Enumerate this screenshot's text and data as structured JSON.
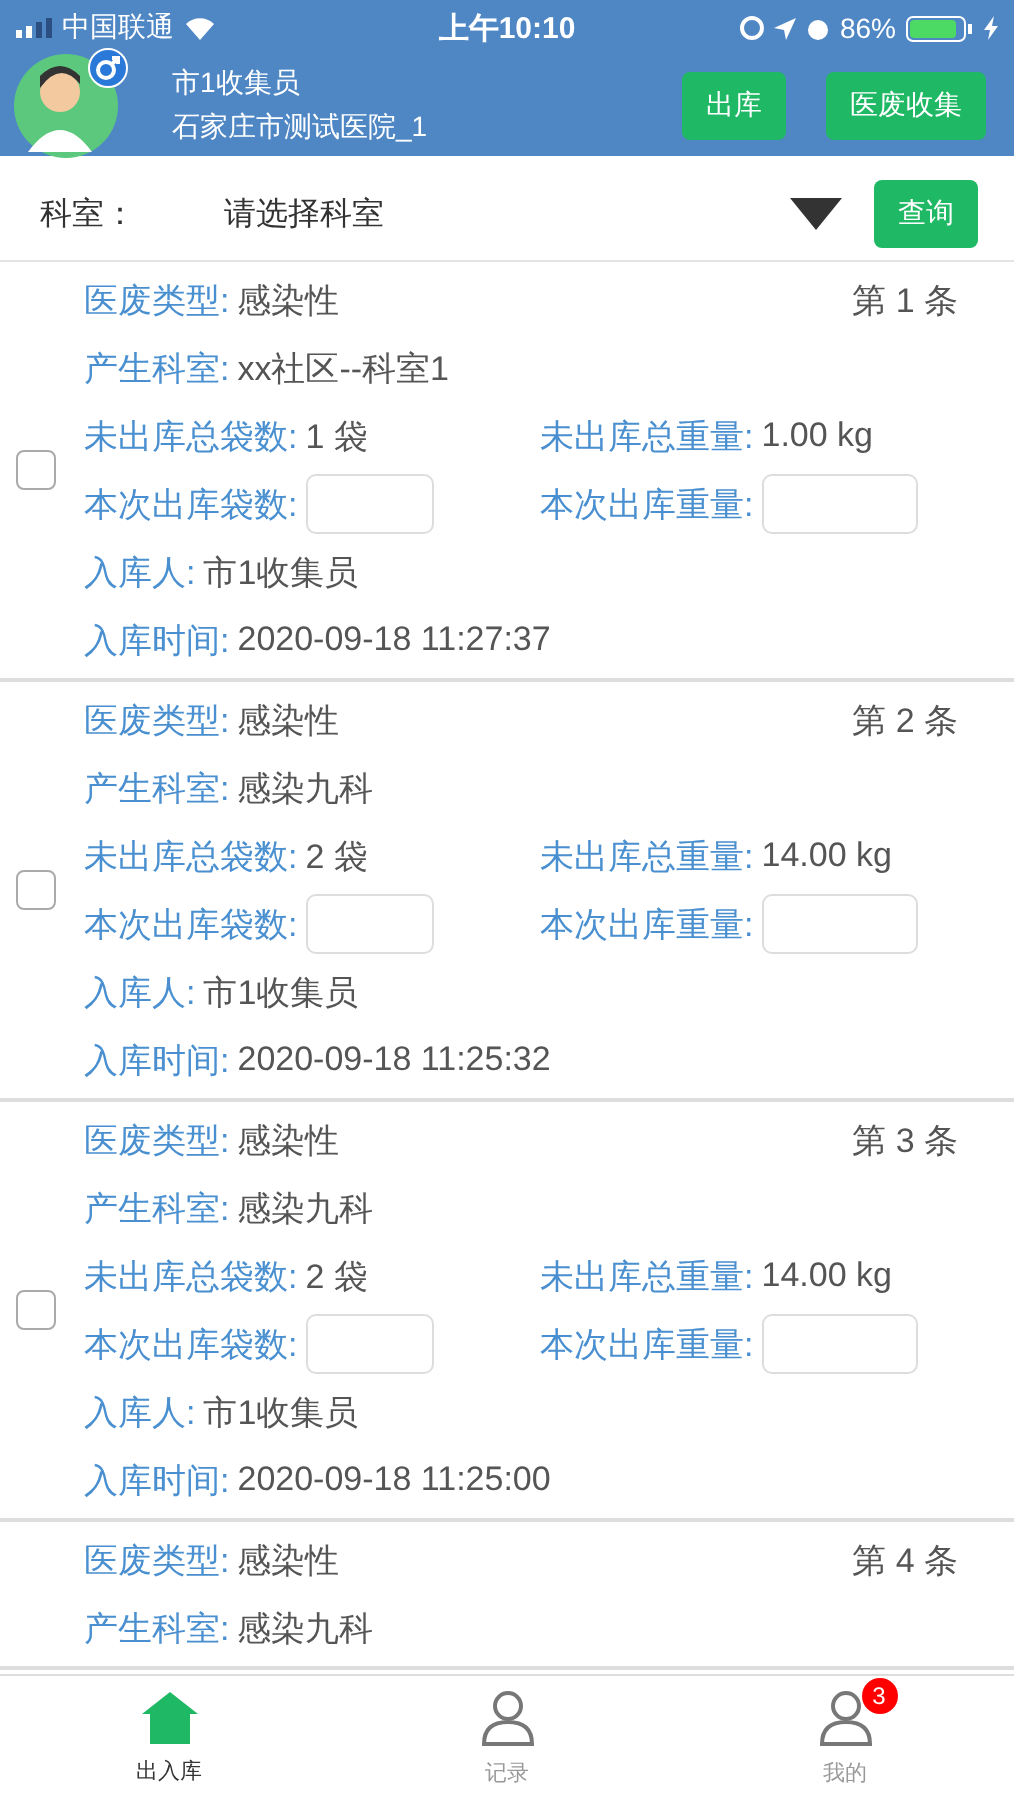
{
  "status_bar": {
    "carrier": "中国联通",
    "time": "上午10:10",
    "battery": "86%"
  },
  "header": {
    "name": "市1收集员",
    "hospital": "石家庄市测试医院_1",
    "buttons": [
      "出库",
      "医废收集"
    ]
  },
  "filter": {
    "label": "科室：",
    "placeholder": "请选择科室",
    "button": "查询"
  },
  "records": [
    {
      "number": "第 1 条",
      "checked": false,
      "lines": [
        [
          {
            "kind": "text",
            "label": "医废类型:",
            "value": "感染性"
          }
        ],
        [
          {
            "kind": "text",
            "label": "产生科室:",
            "value": "xx社区--科室1"
          }
        ],
        [
          {
            "kind": "text",
            "label": "未出库总袋数:",
            "value": "1 袋"
          },
          {
            "kind": "text",
            "label": "未出库总重量:",
            "value": "1.00 kg"
          }
        ],
        [
          {
            "kind": "input",
            "label": "本次出库袋数:"
          },
          {
            "kind": "input",
            "label": "本次出库重量:"
          }
        ],
        [
          {
            "kind": "text",
            "label": "入库人:",
            "value": "市1收集员"
          }
        ],
        [
          {
            "kind": "text",
            "label": "入库时间:",
            "value": "2020-09-18 11:27:37"
          }
        ]
      ]
    },
    {
      "number": "第 2 条",
      "checked": false,
      "lines": [
        [
          {
            "kind": "text",
            "label": "医废类型:",
            "value": "感染性"
          }
        ],
        [
          {
            "kind": "text",
            "label": "产生科室:",
            "value": "感染九科"
          }
        ],
        [
          {
            "kind": "text",
            "label": "未出库总袋数:",
            "value": "2 袋"
          },
          {
            "kind": "text",
            "label": "未出库总重量:",
            "value": "14.00 kg"
          }
        ],
        [
          {
            "kind": "input",
            "label": "本次出库袋数:"
          },
          {
            "kind": "input",
            "label": "本次出库重量:"
          }
        ],
        [
          {
            "kind": "text",
            "label": "入库人:",
            "value": "市1收集员"
          }
        ],
        [
          {
            "kind": "text",
            "label": "入库时间:",
            "value": "2020-09-18 11:25:32"
          }
        ]
      ]
    },
    {
      "number": "第 3 条",
      "checked": false,
      "lines": [
        [
          {
            "kind": "text",
            "label": "医废类型:",
            "value": "感染性"
          }
        ],
        [
          {
            "kind": "text",
            "label": "产生科室:",
            "value": "感染九科"
          }
        ],
        [
          {
            "kind": "text",
            "label": "未出库总袋数:",
            "value": "2 袋"
          },
          {
            "kind": "text",
            "label": "未出库总重量:",
            "value": "14.00 kg"
          }
        ],
        [
          {
            "kind": "input",
            "label": "本次出库袋数:"
          },
          {
            "kind": "input",
            "label": "本次出库重量:"
          }
        ],
        [
          {
            "kind": "text",
            "label": "入库人:",
            "value": "市1收集员"
          }
        ],
        [
          {
            "kind": "text",
            "label": "入库时间:",
            "value": "2020-09-18 11:25:00"
          }
        ]
      ]
    },
    {
      "number": "第 4 条",
      "lines": [
        [
          {
            "kind": "text",
            "label": "医废类型:",
            "value": "感染性"
          }
        ],
        [
          {
            "kind": "text",
            "label": "产生科室:",
            "value": "感染九科"
          }
        ]
      ]
    }
  ],
  "tab_bar": [
    {
      "label": "出入库",
      "kind": "home",
      "selected": true
    },
    {
      "label": "记录",
      "kind": "person",
      "selected": false
    },
    {
      "label": "我的",
      "kind": "person",
      "selected": false,
      "badge": "3"
    }
  ]
}
